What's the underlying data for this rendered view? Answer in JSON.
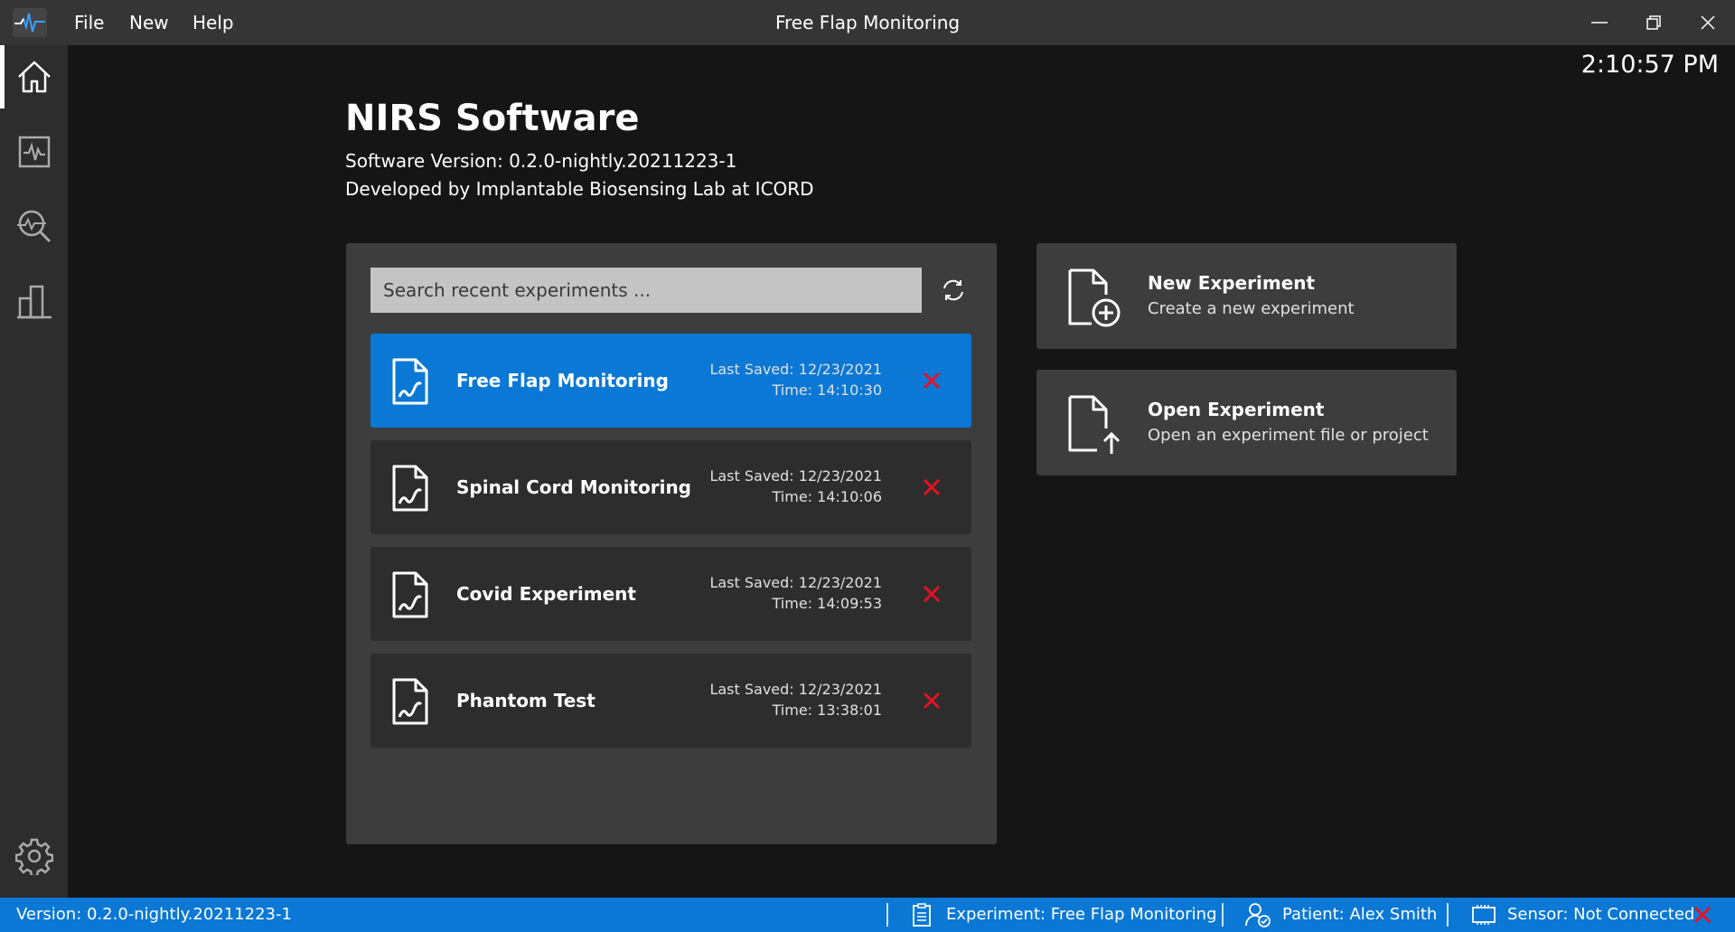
{
  "window": {
    "title": "Free Flap Monitoring",
    "menu": [
      "File",
      "New",
      "Help"
    ]
  },
  "sidebar": {
    "items": [
      {
        "name": "home",
        "icon": "home-icon",
        "active": true
      },
      {
        "name": "monitor",
        "icon": "waveform-icon"
      },
      {
        "name": "analysis",
        "icon": "magnify-chart-icon"
      },
      {
        "name": "reports",
        "icon": "bar-chart-icon"
      }
    ],
    "settings_icon": "gear-icon"
  },
  "clock": "2:10:57 PM",
  "header": {
    "title": "NIRS Software",
    "version_line": "Software Version: 0.2.0-nightly.20211223-1",
    "developer_line": "Developed by Implantable Biosensing Lab at ICORD"
  },
  "recent": {
    "search_placeholder": "Search recent experiments ...",
    "experiments": [
      {
        "name": "Free Flap Monitoring",
        "saved": "Last Saved: 12/23/2021",
        "time": "Time: 14:10:30",
        "active": true
      },
      {
        "name": "Spinal Cord Monitoring",
        "saved": "Last Saved: 12/23/2021",
        "time": "Time: 14:10:06"
      },
      {
        "name": "Covid Experiment",
        "saved": "Last Saved: 12/23/2021",
        "time": "Time: 14:09:53"
      },
      {
        "name": "Phantom Test",
        "saved": "Last Saved: 12/23/2021",
        "time": "Time: 13:38:01"
      }
    ]
  },
  "actions": [
    {
      "title": "New Experiment",
      "desc": "Create a new experiment"
    },
    {
      "title": "Open Experiment",
      "desc": "Open an experiment file or project"
    }
  ],
  "status": {
    "version": "Version: 0.2.0-nightly.20211223-1",
    "experiment": "Experiment: Free Flap Monitoring",
    "patient": "Patient: Alex Smith",
    "sensor": "Sensor: Not Connected"
  },
  "colors": {
    "accent": "#0a78d4",
    "danger": "#e81123",
    "panel": "#3d3d3d",
    "card": "#2d2d2d"
  }
}
